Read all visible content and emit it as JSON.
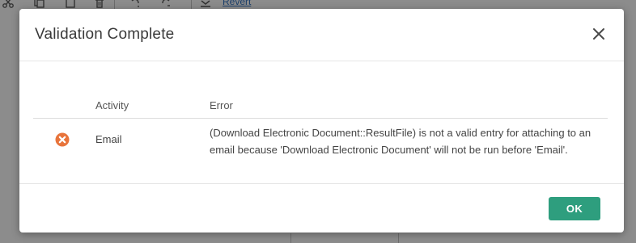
{
  "background": {
    "toolbar": {
      "icons": [
        "scissors-icon",
        "copy-icon",
        "paste-icon",
        "delete-icon",
        "undo-icon",
        "redo-icon",
        "download-icon"
      ],
      "revert_label": "Revert"
    }
  },
  "dialog": {
    "title": "Validation Complete",
    "close_icon": "close-icon",
    "table": {
      "headers": {
        "activity": "Activity",
        "error": "Error"
      },
      "rows": [
        {
          "status_icon": "error-icon",
          "activity": "Email",
          "error": "(Download Electronic Document::ResultFile) is not a valid entry for attaching to an email because 'Download Electronic Document' will not be run before 'Email'."
        }
      ]
    },
    "ok_label": "OK"
  },
  "colors": {
    "accent": "#2e9e7e",
    "error": "#e8743b",
    "overlay": "#8c8c8c"
  }
}
